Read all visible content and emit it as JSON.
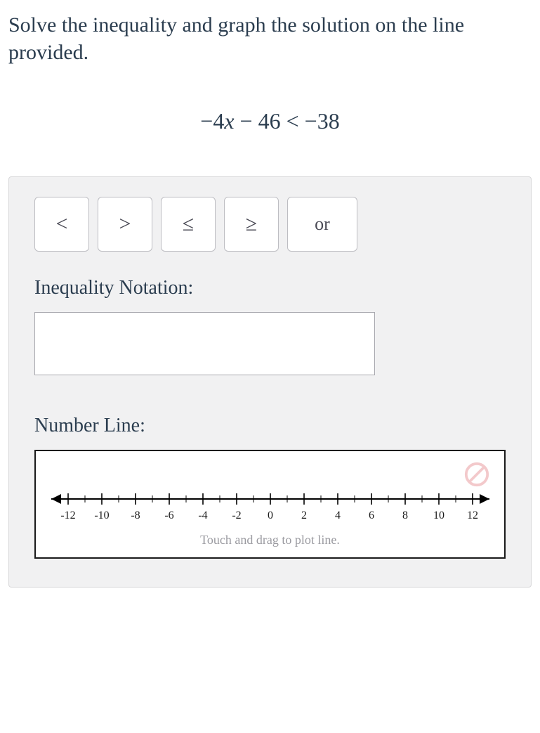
{
  "prompt": "Solve the inequality and graph the solution on the line provided.",
  "equation": {
    "lhs_coef": "−4",
    "lhs_var": "x",
    "lhs_minus": " − 46",
    "rel": " < ",
    "rhs": "−38"
  },
  "operators": {
    "lt": "<",
    "gt": ">",
    "le": "≤",
    "ge": "≥",
    "or": "or"
  },
  "labels": {
    "inequality_notation": "Inequality Notation:",
    "number_line": "Number Line:",
    "touch_drag": "Touch and drag to plot line."
  },
  "answer_value": "",
  "chart_data": {
    "type": "line",
    "x": [
      -12,
      -10,
      -8,
      -6,
      -4,
      -2,
      0,
      2,
      4,
      6,
      8,
      10,
      12
    ],
    "tick_labels": [
      "-12",
      "-10",
      "-8",
      "-6",
      "-4",
      "-2",
      "0",
      "2",
      "4",
      "6",
      "8",
      "10",
      "12"
    ],
    "minor_interval": 1,
    "xlim": [
      -13,
      13
    ],
    "title": "",
    "xlabel": "",
    "ylabel": ""
  }
}
